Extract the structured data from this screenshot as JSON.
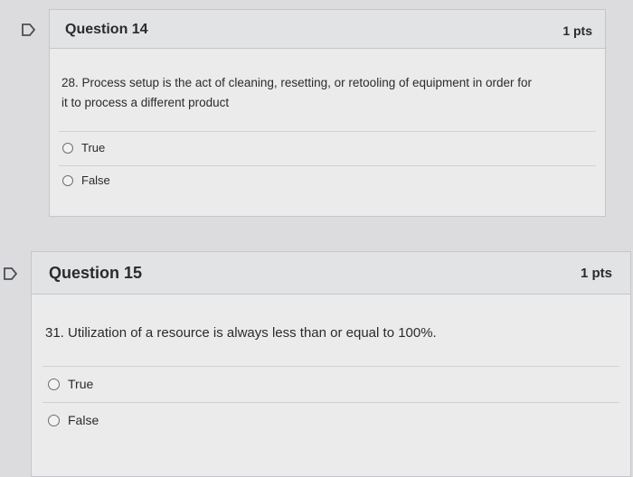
{
  "questions": [
    {
      "title": "Question 14",
      "points": "1 pts",
      "text_line1": "28. Process setup is the act of cleaning, resetting, or retooling of equipment in order for",
      "text_line2": "it to process a different product",
      "answers": [
        "True",
        "False"
      ]
    },
    {
      "title": "Question 15",
      "points": "1 pts",
      "text_line1": "31. Utilization of a resource is always less than or equal to 100%.",
      "answers": [
        "True",
        "False"
      ]
    }
  ],
  "icons": {
    "flag": "flag-outline-icon"
  },
  "colors": {
    "background": "#dcdcde",
    "card": "#ebebec",
    "header": "#e2e3e5",
    "border": "#c4c6c9"
  }
}
